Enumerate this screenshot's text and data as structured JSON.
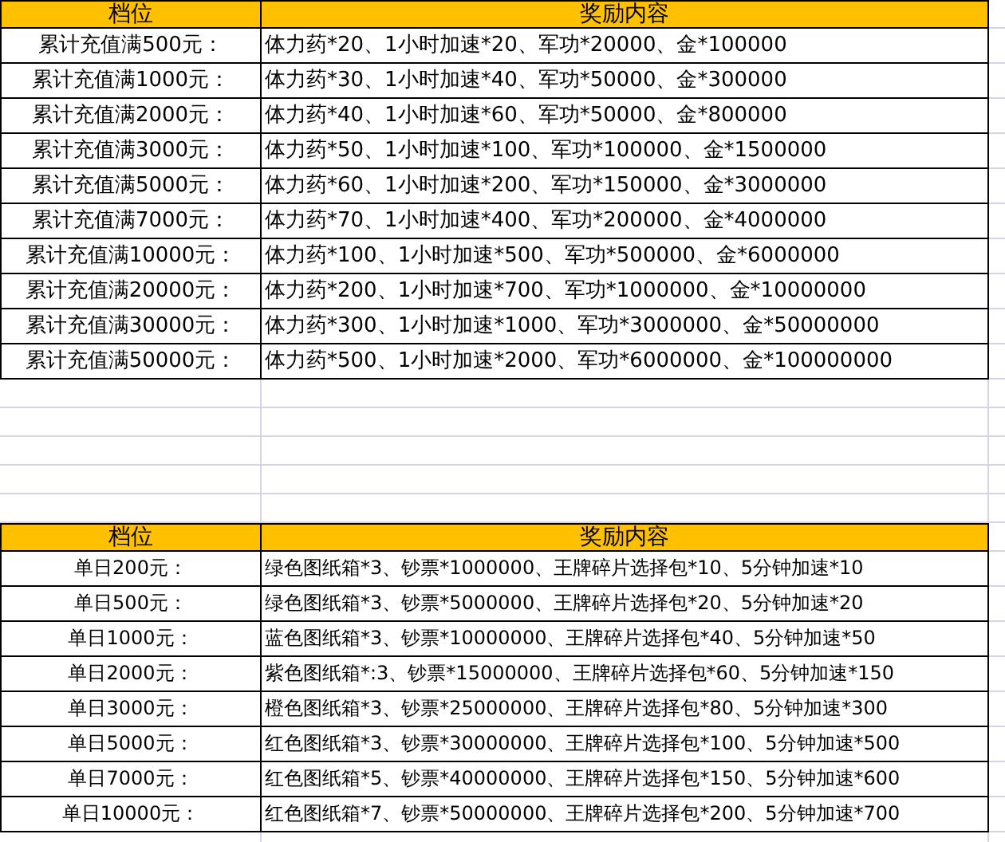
{
  "tables": [
    {
      "columns": [
        "档位",
        "奖励内容"
      ],
      "rows": [
        {
          "tier": "累计充值满500元：",
          "reward": "体力药*20、1小时加速*20、军功*20000、金*100000"
        },
        {
          "tier": "累计充值满1000元：",
          "reward": "体力药*30、1小时加速*40、军功*50000、金*300000"
        },
        {
          "tier": "累计充值满2000元：",
          "reward": "体力药*40、1小时加速*60、军功*50000、金*800000"
        },
        {
          "tier": "累计充值满3000元：",
          "reward": "体力药*50、1小时加速*100、军功*100000、金*1500000"
        },
        {
          "tier": "累计充值满5000元：",
          "reward": "体力药*60、1小时加速*200、军功*150000、金*3000000"
        },
        {
          "tier": "累计充值满7000元：",
          "reward": "体力药*70、1小时加速*400、军功*200000、金*4000000"
        },
        {
          "tier": "累计充值满10000元：",
          "reward": "体力药*100、1小时加速*500、军功*500000、金*6000000"
        },
        {
          "tier": "累计充值满20000元：",
          "reward": "体力药*200、1小时加速*700、军功*1000000、金*10000000"
        },
        {
          "tier": "累计充值满30000元：",
          "reward": "体力药*300、1小时加速*1000、军功*3000000、金*50000000"
        },
        {
          "tier": "累计充值满50000元：",
          "reward": "体力药*500、1小时加速*2000、军功*6000000、金*100000000"
        }
      ]
    },
    {
      "columns": [
        "档位",
        "奖励内容"
      ],
      "rows": [
        {
          "tier": "单日200元：",
          "reward": "绿色图纸箱*3、钞票*1000000、王牌碎片选择包*10、5分钟加速*10"
        },
        {
          "tier": "单日500元：",
          "reward": "绿色图纸箱*3、钞票*5000000、王牌碎片选择包*20、5分钟加速*20"
        },
        {
          "tier": "单日1000元：",
          "reward": "蓝色图纸箱*3、钞票*10000000、王牌碎片选择包*40、5分钟加速*50"
        },
        {
          "tier": "单日2000元：",
          "reward": "紫色图纸箱*:3、钞票*15000000、王牌碎片选择包*60、5分钟加速*150"
        },
        {
          "tier": "单日3000元：",
          "reward": "橙色图纸箱*3、钞票*25000000、王牌碎片选择包*80、5分钟加速*300"
        },
        {
          "tier": "单日5000元：",
          "reward": "红色图纸箱*3、钞票*30000000、王牌碎片选择包*100、5分钟加速*500"
        },
        {
          "tier": "单日7000元：",
          "reward": "红色图纸箱*5、钞票*40000000、王牌碎片选择包*150、5分钟加速*600"
        },
        {
          "tier": "单日10000元：",
          "reward": "红色图纸箱*7、钞票*50000000、王牌碎片选择包*200、5分钟加速*700"
        }
      ]
    }
  ]
}
